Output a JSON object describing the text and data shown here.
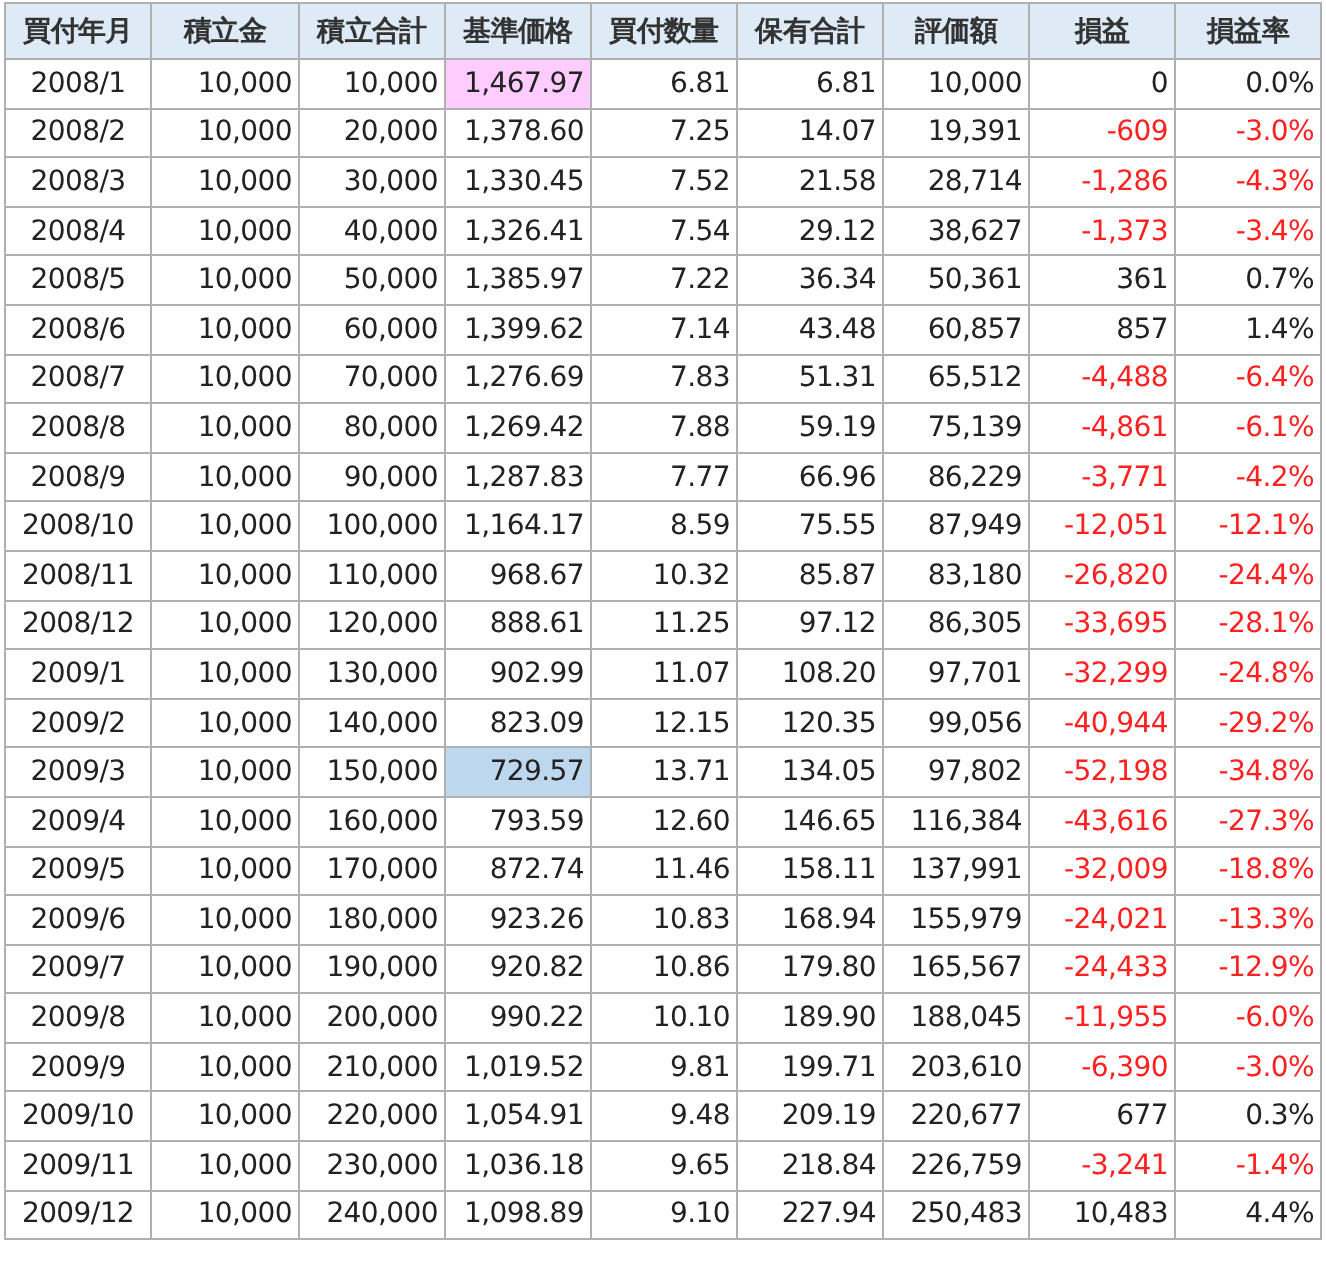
{
  "table": {
    "columns": [
      "買付年月",
      "積立金",
      "積立合計",
      "基準価格",
      "買付数量",
      "保有合計",
      "評価額",
      "損益",
      "損益率"
    ],
    "rows": [
      {
        "month": "2008/1",
        "deposit": "10,000",
        "total": "10,000",
        "price": "1,467.97",
        "price_highest": true,
        "price_lowest": false,
        "units": "6.81",
        "holding": "6.81",
        "value": "10,000",
        "gain": "0",
        "gain_rate": "0.0%",
        "loss": false
      },
      {
        "month": "2008/2",
        "deposit": "10,000",
        "total": "20,000",
        "price": "1,378.60",
        "price_highest": false,
        "price_lowest": false,
        "units": "7.25",
        "holding": "14.07",
        "value": "19,391",
        "gain": "-609",
        "gain_rate": "-3.0%",
        "loss": true
      },
      {
        "month": "2008/3",
        "deposit": "10,000",
        "total": "30,000",
        "price": "1,330.45",
        "price_highest": false,
        "price_lowest": false,
        "units": "7.52",
        "holding": "21.58",
        "value": "28,714",
        "gain": "-1,286",
        "gain_rate": "-4.3%",
        "loss": true
      },
      {
        "month": "2008/4",
        "deposit": "10,000",
        "total": "40,000",
        "price": "1,326.41",
        "price_highest": false,
        "price_lowest": false,
        "units": "7.54",
        "holding": "29.12",
        "value": "38,627",
        "gain": "-1,373",
        "gain_rate": "-3.4%",
        "loss": true
      },
      {
        "month": "2008/5",
        "deposit": "10,000",
        "total": "50,000",
        "price": "1,385.97",
        "price_highest": false,
        "price_lowest": false,
        "units": "7.22",
        "holding": "36.34",
        "value": "50,361",
        "gain": "361",
        "gain_rate": "0.7%",
        "loss": false
      },
      {
        "month": "2008/6",
        "deposit": "10,000",
        "total": "60,000",
        "price": "1,399.62",
        "price_highest": false,
        "price_lowest": false,
        "units": "7.14",
        "holding": "43.48",
        "value": "60,857",
        "gain": "857",
        "gain_rate": "1.4%",
        "loss": false
      },
      {
        "month": "2008/7",
        "deposit": "10,000",
        "total": "70,000",
        "price": "1,276.69",
        "price_highest": false,
        "price_lowest": false,
        "units": "7.83",
        "holding": "51.31",
        "value": "65,512",
        "gain": "-4,488",
        "gain_rate": "-6.4%",
        "loss": true
      },
      {
        "month": "2008/8",
        "deposit": "10,000",
        "total": "80,000",
        "price": "1,269.42",
        "price_highest": false,
        "price_lowest": false,
        "units": "7.88",
        "holding": "59.19",
        "value": "75,139",
        "gain": "-4,861",
        "gain_rate": "-6.1%",
        "loss": true
      },
      {
        "month": "2008/9",
        "deposit": "10,000",
        "total": "90,000",
        "price": "1,287.83",
        "price_highest": false,
        "price_lowest": false,
        "units": "7.77",
        "holding": "66.96",
        "value": "86,229",
        "gain": "-3,771",
        "gain_rate": "-4.2%",
        "loss": true
      },
      {
        "month": "2008/10",
        "deposit": "10,000",
        "total": "100,000",
        "price": "1,164.17",
        "price_highest": false,
        "price_lowest": false,
        "units": "8.59",
        "holding": "75.55",
        "value": "87,949",
        "gain": "-12,051",
        "gain_rate": "-12.1%",
        "loss": true
      },
      {
        "month": "2008/11",
        "deposit": "10,000",
        "total": "110,000",
        "price": "968.67",
        "price_highest": false,
        "price_lowest": false,
        "units": "10.32",
        "holding": "85.87",
        "value": "83,180",
        "gain": "-26,820",
        "gain_rate": "-24.4%",
        "loss": true
      },
      {
        "month": "2008/12",
        "deposit": "10,000",
        "total": "120,000",
        "price": "888.61",
        "price_highest": false,
        "price_lowest": false,
        "units": "11.25",
        "holding": "97.12",
        "value": "86,305",
        "gain": "-33,695",
        "gain_rate": "-28.1%",
        "loss": true
      },
      {
        "month": "2009/1",
        "deposit": "10,000",
        "total": "130,000",
        "price": "902.99",
        "price_highest": false,
        "price_lowest": false,
        "units": "11.07",
        "holding": "108.20",
        "value": "97,701",
        "gain": "-32,299",
        "gain_rate": "-24.8%",
        "loss": true
      },
      {
        "month": "2009/2",
        "deposit": "10,000",
        "total": "140,000",
        "price": "823.09",
        "price_highest": false,
        "price_lowest": false,
        "units": "12.15",
        "holding": "120.35",
        "value": "99,056",
        "gain": "-40,944",
        "gain_rate": "-29.2%",
        "loss": true
      },
      {
        "month": "2009/3",
        "deposit": "10,000",
        "total": "150,000",
        "price": "729.57",
        "price_highest": false,
        "price_lowest": true,
        "units": "13.71",
        "holding": "134.05",
        "value": "97,802",
        "gain": "-52,198",
        "gain_rate": "-34.8%",
        "loss": true
      },
      {
        "month": "2009/4",
        "deposit": "10,000",
        "total": "160,000",
        "price": "793.59",
        "price_highest": false,
        "price_lowest": false,
        "units": "12.60",
        "holding": "146.65",
        "value": "116,384",
        "gain": "-43,616",
        "gain_rate": "-27.3%",
        "loss": true
      },
      {
        "month": "2009/5",
        "deposit": "10,000",
        "total": "170,000",
        "price": "872.74",
        "price_highest": false,
        "price_lowest": false,
        "units": "11.46",
        "holding": "158.11",
        "value": "137,991",
        "gain": "-32,009",
        "gain_rate": "-18.8%",
        "loss": true
      },
      {
        "month": "2009/6",
        "deposit": "10,000",
        "total": "180,000",
        "price": "923.26",
        "price_highest": false,
        "price_lowest": false,
        "units": "10.83",
        "holding": "168.94",
        "value": "155,979",
        "gain": "-24,021",
        "gain_rate": "-13.3%",
        "loss": true
      },
      {
        "month": "2009/7",
        "deposit": "10,000",
        "total": "190,000",
        "price": "920.82",
        "price_highest": false,
        "price_lowest": false,
        "units": "10.86",
        "holding": "179.80",
        "value": "165,567",
        "gain": "-24,433",
        "gain_rate": "-12.9%",
        "loss": true
      },
      {
        "month": "2009/8",
        "deposit": "10,000",
        "total": "200,000",
        "price": "990.22",
        "price_highest": false,
        "price_lowest": false,
        "units": "10.10",
        "holding": "189.90",
        "value": "188,045",
        "gain": "-11,955",
        "gain_rate": "-6.0%",
        "loss": true
      },
      {
        "month": "2009/9",
        "deposit": "10,000",
        "total": "210,000",
        "price": "1,019.52",
        "price_highest": false,
        "price_lowest": false,
        "units": "9.81",
        "holding": "199.71",
        "value": "203,610",
        "gain": "-6,390",
        "gain_rate": "-3.0%",
        "loss": true
      },
      {
        "month": "2009/10",
        "deposit": "10,000",
        "total": "220,000",
        "price": "1,054.91",
        "price_highest": false,
        "price_lowest": false,
        "units": "9.48",
        "holding": "209.19",
        "value": "220,677",
        "gain": "677",
        "gain_rate": "0.3%",
        "loss": false
      },
      {
        "month": "2009/11",
        "deposit": "10,000",
        "total": "230,000",
        "price": "1,036.18",
        "price_highest": false,
        "price_lowest": false,
        "units": "9.65",
        "holding": "218.84",
        "value": "226,759",
        "gain": "-3,241",
        "gain_rate": "-1.4%",
        "loss": true
      },
      {
        "month": "2009/12",
        "deposit": "10,000",
        "total": "240,000",
        "price": "1,098.89",
        "price_highest": false,
        "price_lowest": false,
        "units": "9.10",
        "holding": "227.94",
        "value": "250,483",
        "gain": "10,483",
        "gain_rate": "4.4%",
        "loss": false
      }
    ]
  }
}
